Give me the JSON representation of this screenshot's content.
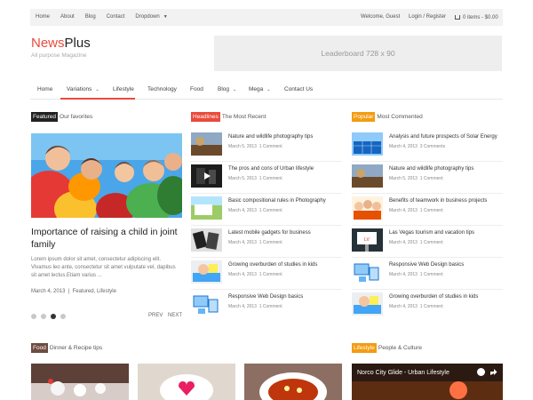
{
  "topbar": {
    "links": [
      "Home",
      "About",
      "Blog",
      "Contact",
      "Dropdown"
    ],
    "welcome": "Welcome, Guest",
    "login": "Login / Register",
    "cart": "0 items - $0.00"
  },
  "header": {
    "logo_part1": "News",
    "logo_part2": "Plus",
    "tagline": "All purpose Magazine",
    "leaderboard": "Leaderboard 728 x 90"
  },
  "nav": {
    "items": [
      "Home",
      "Variations",
      "Lifestyle",
      "Technology",
      "Food",
      "Blog",
      "Mega",
      "Contact Us"
    ]
  },
  "featured": {
    "tag": "Featured",
    "heading": "Our favorites",
    "title": "Importance of raising a child in joint family",
    "excerpt": "Lorem ipsum dolor sit amet, consectetur adipiscing elit. Vivamus leo ante, consectetur sit amet vulputate vel, dapibus sit amet lectus.Etiam varius ...",
    "date": "March 4, 2013",
    "categories": "Featured, Lifestyle",
    "prev": "PREV",
    "next": "NEXT"
  },
  "headlines": {
    "tag": "Headlines",
    "heading": "The Most Recent",
    "items": [
      {
        "title": "Nature and wildlife photography tips",
        "date": "March 5, 2013",
        "comments": "1 Comment"
      },
      {
        "title": "The pros and cons of Urban lifestyle",
        "date": "March 5, 2013",
        "comments": "1 Comment"
      },
      {
        "title": "Basic compositional rules in Photography",
        "date": "March 4, 2013",
        "comments": "1 Comment"
      },
      {
        "title": "Latest mobile gadgets for business",
        "date": "March 4, 2013",
        "comments": "1 Comment"
      },
      {
        "title": "Growing overburden of studies in kids",
        "date": "March 4, 2013",
        "comments": "1 Comment"
      },
      {
        "title": "Responsive Web Design basics",
        "date": "March 4, 2013",
        "comments": "1 Comment"
      }
    ]
  },
  "popular": {
    "tag": "Popular",
    "heading": "Most Commented",
    "items": [
      {
        "title": "Analysis and future prospects of Solar Energy",
        "date": "March 4, 2013",
        "comments": "3 Comments"
      },
      {
        "title": "Nature and wildlife photography tips",
        "date": "March 5, 2013",
        "comments": "1 Comment"
      },
      {
        "title": "Benefits of teamwork in business projects",
        "date": "March 4, 2013",
        "comments": "1 Comment"
      },
      {
        "title": "Las Vegas tourism and vacation tips",
        "date": "March 4, 2013",
        "comments": "1 Comment"
      },
      {
        "title": "Responsive Web Design basics",
        "date": "March 4, 2013",
        "comments": "1 Comment"
      },
      {
        "title": "Growing overburden of studies in kids",
        "date": "March 4, 2013",
        "comments": "1 Comment"
      }
    ]
  },
  "food": {
    "tag": "Food",
    "heading": "Dinner & Recipe tips"
  },
  "lifestyle": {
    "tag": "Lifestyle",
    "heading": "People & Culture",
    "video_title": "Norco City Glide - Urban Lifestyle"
  },
  "colors": {
    "accent": "#e84b3c",
    "popular": "#f39c12",
    "featured": "#222222",
    "food": "#6d4c41"
  }
}
